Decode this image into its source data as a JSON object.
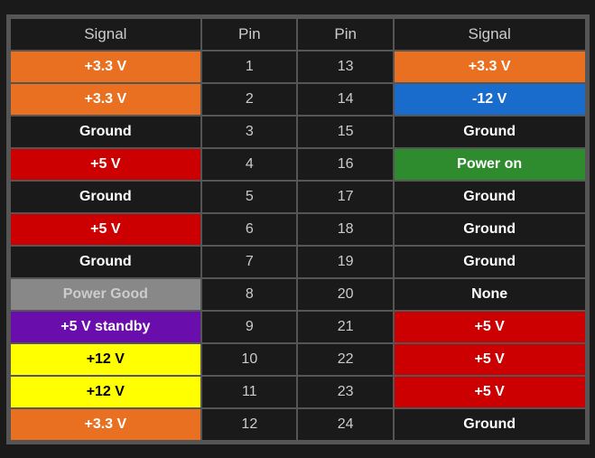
{
  "headers": {
    "signal_left": "Signal",
    "pin_left": "Pin",
    "pin_right": "Pin",
    "signal_right": "Signal"
  },
  "rows": [
    {
      "signal_left": "+3.3 V",
      "sl_class": "bg-orange",
      "pin_left": "1",
      "pin_right": "13",
      "signal_right": "+3.3 V",
      "sr_class": "bg-orange"
    },
    {
      "signal_left": "+3.3 V",
      "sl_class": "bg-orange",
      "pin_left": "2",
      "pin_right": "14",
      "signal_right": "-12 V",
      "sr_class": "bg-blue"
    },
    {
      "signal_left": "Ground",
      "sl_class": "bg-black",
      "pin_left": "3",
      "pin_right": "15",
      "signal_right": "Ground",
      "sr_class": "bg-black"
    },
    {
      "signal_left": "+5 V",
      "sl_class": "bg-red",
      "pin_left": "4",
      "pin_right": "16",
      "signal_right": "Power on",
      "sr_class": "bg-green"
    },
    {
      "signal_left": "Ground",
      "sl_class": "bg-black",
      "pin_left": "5",
      "pin_right": "17",
      "signal_right": "Ground",
      "sr_class": "bg-black"
    },
    {
      "signal_left": "+5 V",
      "sl_class": "bg-red",
      "pin_left": "6",
      "pin_right": "18",
      "signal_right": "Ground",
      "sr_class": "bg-black"
    },
    {
      "signal_left": "Ground",
      "sl_class": "bg-black",
      "pin_left": "7",
      "pin_right": "19",
      "signal_right": "Ground",
      "sr_class": "bg-black"
    },
    {
      "signal_left": "Power Good",
      "sl_class": "bg-gray",
      "pin_left": "8",
      "pin_right": "20",
      "signal_right": "None",
      "sr_class": "bg-black"
    },
    {
      "signal_left": "+5 V standby",
      "sl_class": "bg-purple",
      "pin_left": "9",
      "pin_right": "21",
      "signal_right": "+5 V",
      "sr_class": "bg-red"
    },
    {
      "signal_left": "+12 V",
      "sl_class": "bg-yellow",
      "pin_left": "10",
      "pin_right": "22",
      "signal_right": "+5 V",
      "sr_class": "bg-red"
    },
    {
      "signal_left": "+12 V",
      "sl_class": "bg-yellow",
      "pin_left": "11",
      "pin_right": "23",
      "signal_right": "+5 V",
      "sr_class": "bg-red"
    },
    {
      "signal_left": "+3.3 V",
      "sl_class": "bg-orange",
      "pin_left": "12",
      "pin_right": "24",
      "signal_right": "Ground",
      "sr_class": "bg-black"
    }
  ]
}
